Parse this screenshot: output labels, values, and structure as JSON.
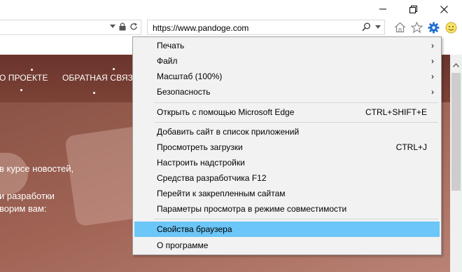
{
  "window": {
    "controls": [
      "minimize",
      "restore",
      "close"
    ]
  },
  "address_bar": {
    "url": "https://www.pandoge.com"
  },
  "toolbar_icons": [
    "home-icon",
    "star-icon",
    "gear-icon",
    "smiley-icon"
  ],
  "site": {
    "nav": [
      {
        "label": "О ПРОЕКТЕ"
      },
      {
        "label": "ОБРАТНАЯ СВЯЗЬ"
      }
    ],
    "text_lines": [
      "в курсе новостей,",
      "и разработки",
      "ворим вам:"
    ]
  },
  "tools_menu": {
    "items": [
      {
        "label": "Печать",
        "shortcut": "",
        "arrow": "›"
      },
      {
        "label": "Файл",
        "shortcut": "",
        "arrow": "›"
      },
      {
        "label": "Масштаб (100%)",
        "shortcut": "",
        "arrow": "›"
      },
      {
        "label": "Безопасность",
        "shortcut": "",
        "arrow": "›"
      },
      {
        "label": "Открыть с помощью Microsoft Edge",
        "shortcut": "CTRL+SHIFT+E",
        "arrow": ""
      },
      {
        "label": "Добавить сайт в список приложений",
        "shortcut": "",
        "arrow": ""
      },
      {
        "label": "Просмотреть загрузки",
        "shortcut": "CTRL+J",
        "arrow": ""
      },
      {
        "label": "Настроить надстройки",
        "shortcut": "",
        "arrow": ""
      },
      {
        "label": "Средства разработчика F12",
        "shortcut": "",
        "arrow": ""
      },
      {
        "label": "Перейти к закрепленным сайтам",
        "shortcut": "",
        "arrow": ""
      },
      {
        "label": "Параметры просмотра в режиме совместимости",
        "shortcut": "",
        "arrow": ""
      },
      {
        "label": "Свойства браузера",
        "shortcut": "",
        "arrow": "",
        "highlighted": true
      },
      {
        "label": "О программе",
        "shortcut": "",
        "arrow": ""
      }
    ]
  },
  "colors": {
    "menu_highlight": "#6cc6f7",
    "gear_icon": "#1e6fd0",
    "site_header": "#6a342d"
  }
}
